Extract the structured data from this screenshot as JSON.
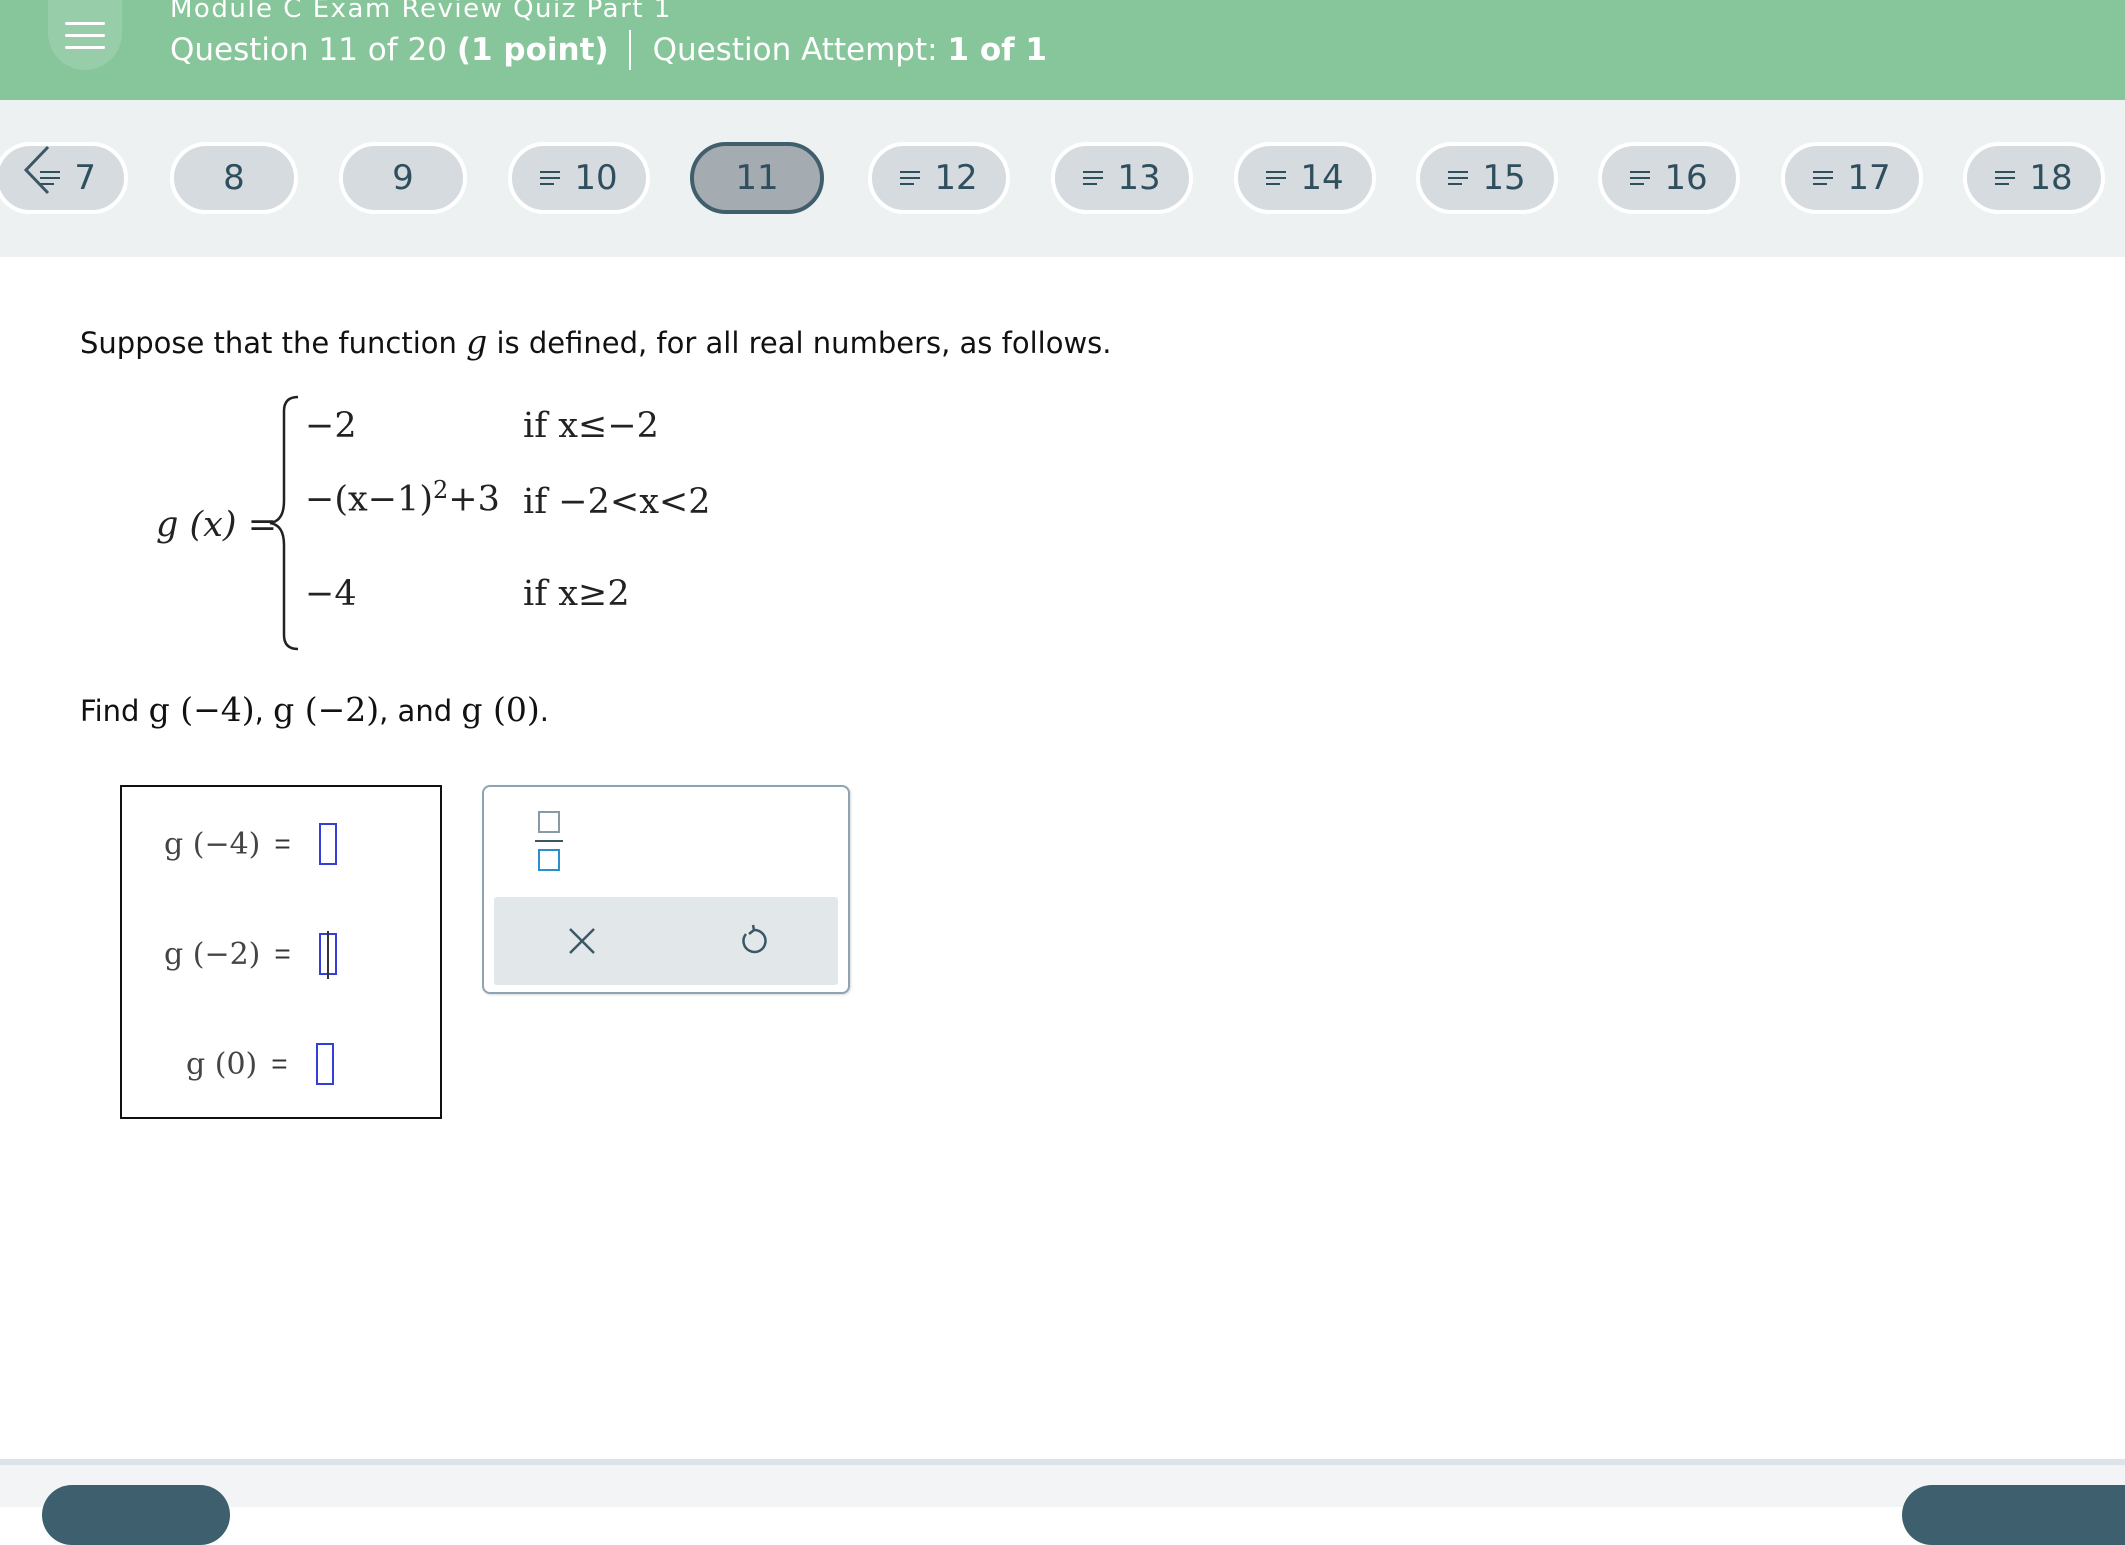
{
  "header": {
    "quiz_title": "Module C Exam Review Quiz Part 1",
    "question_label": "Question 11 of 20",
    "points_label": "(1 point)",
    "attempt_label": "Question Attempt:",
    "attempt_value": "1 of 1"
  },
  "nav": {
    "questions": [
      {
        "label": "7",
        "flagged": true,
        "active": false
      },
      {
        "label": "8",
        "flagged": false,
        "active": false
      },
      {
        "label": "9",
        "flagged": false,
        "active": false
      },
      {
        "label": "10",
        "flagged": true,
        "active": false
      },
      {
        "label": "11",
        "flagged": false,
        "active": true
      },
      {
        "label": "12",
        "flagged": true,
        "active": false
      },
      {
        "label": "13",
        "flagged": true,
        "active": false
      },
      {
        "label": "14",
        "flagged": true,
        "active": false
      },
      {
        "label": "15",
        "flagged": true,
        "active": false
      },
      {
        "label": "16",
        "flagged": true,
        "active": false
      },
      {
        "label": "17",
        "flagged": true,
        "active": false
      },
      {
        "label": "18",
        "flagged": true,
        "active": false
      }
    ]
  },
  "question": {
    "prompt_start": "Suppose that the function",
    "prompt_var": "g",
    "prompt_end": "is defined, for all real numbers, as follows.",
    "function_lhs": "g (x) =",
    "cases": [
      {
        "expr": "−2",
        "cond": "if x≤−2"
      },
      {
        "expr": "−(x−1)",
        "exp": "2",
        "expr_tail": "+3",
        "cond": "if −2<x<2"
      },
      {
        "expr": "−4",
        "cond": "if x≥2"
      }
    ],
    "find_label": "Find",
    "find_items": [
      "g (−4)",
      "g (−2)",
      "g (0)"
    ],
    "find_sep_1": ",",
    "find_sep_2": ", and",
    "find_end": "."
  },
  "answers": {
    "rows": [
      {
        "label": "g (−4)",
        "eq": "=",
        "value": ""
      },
      {
        "label": "g (−2)",
        "eq": "=",
        "value": ""
      },
      {
        "label": "g (0)",
        "eq": "=",
        "value": ""
      }
    ]
  },
  "toolbox": {
    "fraction_icon": "fraction-icon",
    "clear_icon": "close-icon",
    "undo_icon": "undo-icon"
  },
  "colors": {
    "header": "#87c59a",
    "nav_strip": "#eef1f2",
    "pill": "#d6dbdf",
    "pill_active": "#a5acb1",
    "input_border": "#3340d8"
  }
}
